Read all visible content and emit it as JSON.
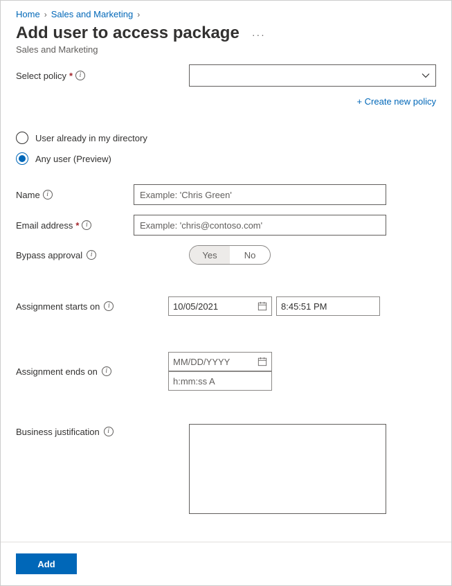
{
  "breadcrumb": {
    "home": "Home",
    "section": "Sales and Marketing"
  },
  "title": "Add user to access package",
  "subtitle": "Sales and Marketing",
  "policy": {
    "label": "Select policy",
    "create_link": "+ Create new policy"
  },
  "radios": {
    "opt1": "User already in my directory",
    "opt2": "Any user (Preview)",
    "selected": "opt2"
  },
  "name_field": {
    "label": "Name",
    "placeholder": "Example: 'Chris Green'"
  },
  "email_field": {
    "label": "Email address",
    "placeholder": "Example: 'chris@contoso.com'"
  },
  "bypass": {
    "label": "Bypass approval",
    "yes": "Yes",
    "no": "No",
    "value": "Yes"
  },
  "starts": {
    "label": "Assignment starts on",
    "date": "10/05/2021",
    "time": "8:45:51 PM"
  },
  "ends": {
    "label": "Assignment ends on",
    "date_ph": "MM/DD/YYYY",
    "time_ph": "h:mm:ss A"
  },
  "biz": {
    "label": "Business justification"
  },
  "footer": {
    "add": "Add"
  }
}
